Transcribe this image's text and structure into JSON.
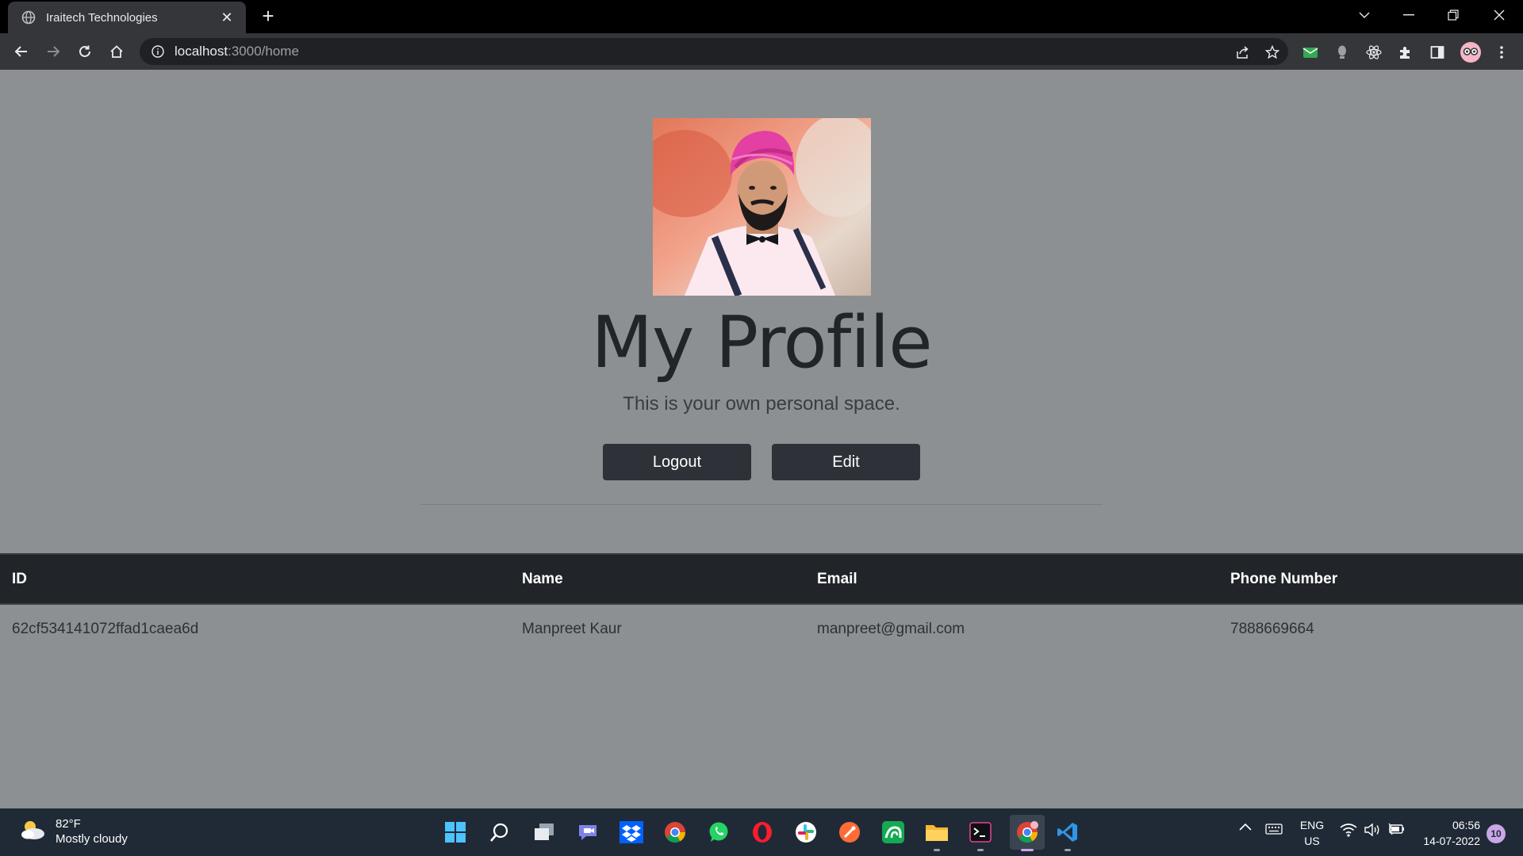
{
  "browser": {
    "tab_title": "Iraitech Technologies",
    "tab_close": "✕",
    "new_tab": "+",
    "url_host": "localhost",
    "url_path": ":3000/home"
  },
  "profile": {
    "title": "My Profile",
    "subtitle": "This is your own personal space.",
    "logout_label": "Logout",
    "edit_label": "Edit"
  },
  "table": {
    "headers": [
      "ID",
      "Name",
      "Email",
      "Phone Number"
    ],
    "rows": [
      [
        "62cf534141072ffad1caea6d",
        "Manpreet Kaur",
        "manpreet@gmail.com",
        "7888669664"
      ]
    ]
  },
  "taskbar": {
    "temperature": "82°F",
    "condition": "Mostly cloudy",
    "lang_1": "ENG",
    "lang_2": "US",
    "time": "06:56",
    "date": "14-07-2022",
    "notifications": "10"
  },
  "colors": {
    "page_background": "#8c9092",
    "button_background": "#2e3238",
    "table_header_background": "#212529"
  }
}
